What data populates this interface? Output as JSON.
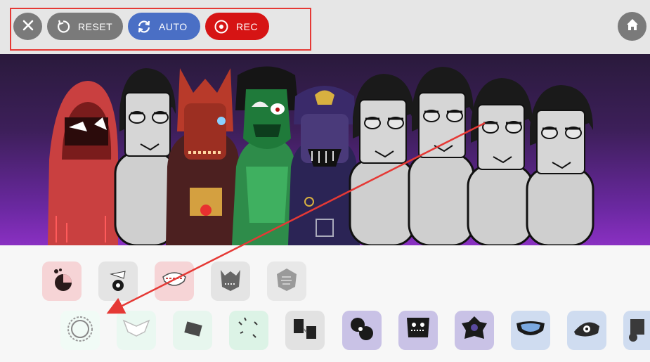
{
  "toolbar": {
    "close_icon": "close-icon",
    "reset_label": "RESET",
    "reset_icon": "reset-icon",
    "auto_label": "AUTO",
    "auto_icon": "auto-icon",
    "rec_label": "REC",
    "rec_icon": "record-icon",
    "home_icon": "home-icon"
  },
  "colors": {
    "toolbar_bg": "#e6e6e6",
    "neutral_button": "#7a7a7a",
    "auto_button": "#4a6fc5",
    "rec_button": "#d61414",
    "annotation": "#e53935",
    "stage_top": "#2a1a3c",
    "stage_bottom": "#8a30c2"
  },
  "stage": {
    "characters": [
      {
        "kind": "red-hooded"
      },
      {
        "kind": "gray-default"
      },
      {
        "kind": "red-demon"
      },
      {
        "kind": "green-mask"
      },
      {
        "kind": "purple-skull"
      },
      {
        "kind": "gray-default"
      },
      {
        "kind": "gray-default"
      },
      {
        "kind": "gray-default"
      },
      {
        "kind": "gray-default"
      }
    ]
  },
  "tray": {
    "row1": [
      {
        "icon": "red-effects-icon",
        "tint": "#f6d4d6"
      },
      {
        "icon": "gray-effects-icon",
        "tint": "#e4e4e4"
      },
      {
        "icon": "red-mask-icon",
        "tint": "#f6d4d6"
      },
      {
        "icon": "gray-mask-icon",
        "tint": "#e4e4e4"
      },
      {
        "icon": "gray-shield-icon",
        "tint": "#e8e8e8"
      }
    ],
    "row2": [
      {
        "icon": "sun-ring-icon",
        "tint": "#f1fbf6"
      },
      {
        "icon": "white-wings-icon",
        "tint": "#eaf8f1"
      },
      {
        "icon": "dark-block-icon",
        "tint": "#e7f6ee"
      },
      {
        "icon": "green-dots-icon",
        "tint": "#dcf3e6"
      },
      {
        "icon": "black-figure-icon",
        "tint": "#e2e2e2"
      },
      {
        "icon": "purple-creature-icon",
        "tint": "#c9c2e6"
      },
      {
        "icon": "purple-face-icon",
        "tint": "#c9c2e6"
      },
      {
        "icon": "purple-flower-icon",
        "tint": "#c9c2e6"
      },
      {
        "icon": "blue-visor-icon",
        "tint": "#cfdcf0"
      },
      {
        "icon": "blue-eye-icon",
        "tint": "#cfdcf0"
      },
      {
        "icon": "blue-cannon-icon",
        "tint": "#cfdcf0"
      }
    ]
  }
}
